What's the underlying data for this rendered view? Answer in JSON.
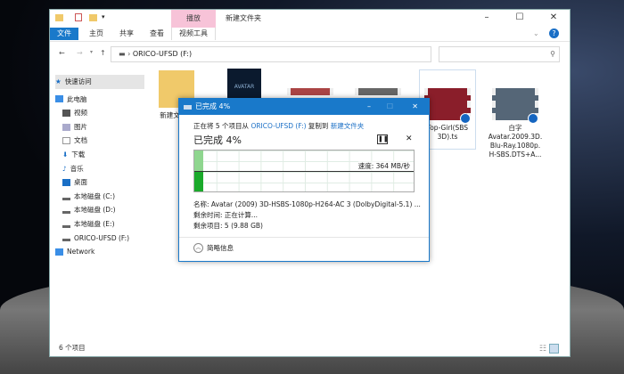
{
  "window": {
    "folder_title": "新建文件夹",
    "context_tab": "播放",
    "quick_access_dropdown": "▾"
  },
  "ribbon": {
    "tabs": [
      "文件",
      "主页",
      "共享",
      "查看",
      "视频工具"
    ]
  },
  "address": {
    "path": "ORICO-UFSD (F:)",
    "search_placeholder": ""
  },
  "nav": {
    "items": [
      "快速访问",
      "此电脑",
      "视频",
      "图片",
      "文档",
      "下载",
      "音乐",
      "桌面",
      "本地磁盘 (C:)",
      "本地磁盘 (D:)",
      "本地磁盘 (E:)",
      "ORICO-UFSD (F:)",
      "Network"
    ]
  },
  "files": [
    {
      "name": "新建文件夹"
    },
    {
      "name": "AVATAR"
    },
    {
      "name": ""
    },
    {
      "name": ""
    },
    {
      "name": "Top-Girl(SBS 3D).ts"
    },
    {
      "name": "白字 Avatar.2009.3D. Blu-Ray.1080p. H-SBS.DTS+A..."
    }
  ],
  "status": {
    "count": "6 个项目"
  },
  "dialog": {
    "title": "已完成 4%",
    "copy_prefix": "正在将 5 个项目从",
    "source": "ORICO-UFSD (F:)",
    "copy_mid": "复制到",
    "dest": "新建文件夹",
    "heading": "已完成 4%",
    "progress_percent": 4,
    "speed": "速度: 364 MB/秒",
    "name_line": "名称: Avatar (2009) 3D-HSBS-1080p-H264-AC 3 (DolbyDigital-5.1) ...",
    "time_line": "剩余时间: 正在计算...",
    "items_line": "剩余项目: 5 (9.88 GB)",
    "less_details": "简略信息"
  }
}
